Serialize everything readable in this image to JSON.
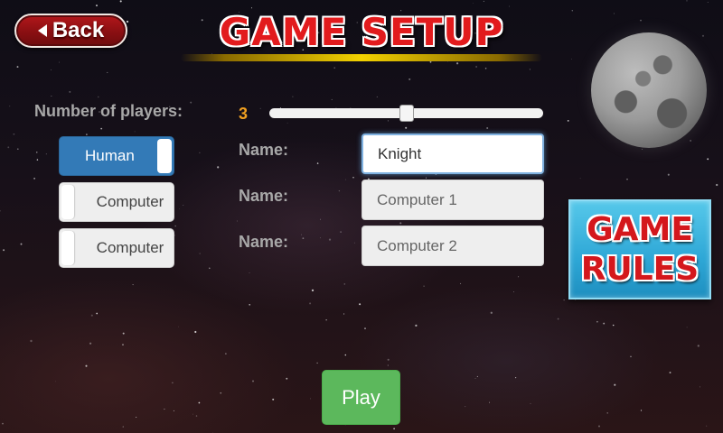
{
  "header": {
    "back_label": "Back",
    "title": "GAME SETUP"
  },
  "players": {
    "label": "Number of players:",
    "count": "3",
    "slider_fraction": 0.5,
    "slots": [
      {
        "type": "Human",
        "name_label": "Name:",
        "name": "Knight"
      },
      {
        "type": "Computer",
        "name_label": "Name:",
        "name": "Computer 1"
      },
      {
        "type": "Computer",
        "name_label": "Name:",
        "name": "Computer 2"
      }
    ]
  },
  "rules_button": {
    "line1": "GAME",
    "line2": "RULES"
  },
  "play_label": "Play",
  "colors": {
    "human_toggle": "#337ab7",
    "play_button": "#5cb85c",
    "title_red": "#e21b1d",
    "count_orange": "#f0a020",
    "rules_cyan": "#2ea7d6"
  }
}
